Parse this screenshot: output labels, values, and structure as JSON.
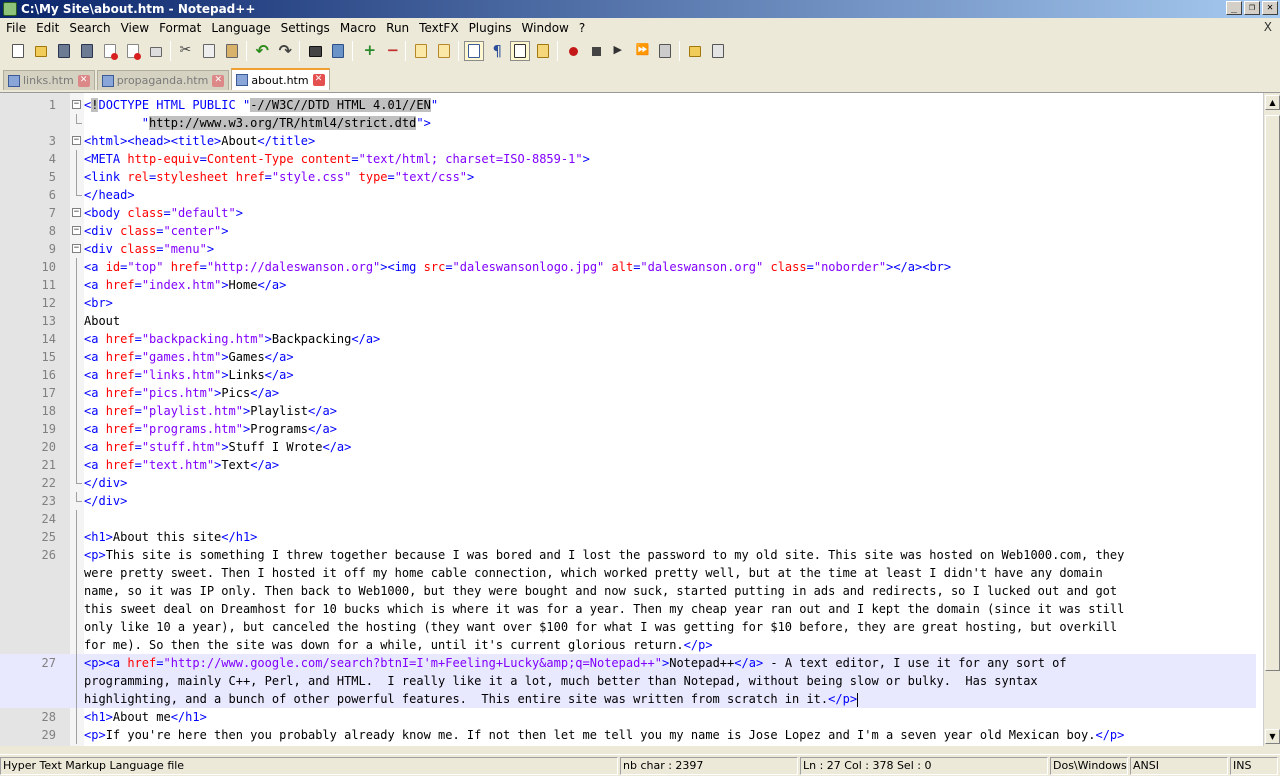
{
  "window": {
    "title": "C:\\My Site\\about.htm - Notepad++",
    "buttons": {
      "minimize": "_",
      "maximize": "❐",
      "close": "✕"
    },
    "doc_close": "X"
  },
  "menu": [
    "File",
    "Edit",
    "Search",
    "View",
    "Format",
    "Language",
    "Settings",
    "Macro",
    "Run",
    "TextFX",
    "Plugins",
    "Window",
    "?"
  ],
  "toolbar": [
    "new-file-icon",
    "open-file-icon",
    "save-icon",
    "save-all-icon",
    "close-icon",
    "close-all-icon",
    "print-icon",
    "cut-icon",
    "copy-icon",
    "paste-icon",
    "undo-icon",
    "redo-icon",
    "find-icon",
    "replace-icon",
    "zoom-in-icon",
    "zoom-out-icon",
    "sync-vertical-icon",
    "sync-horizontal-icon",
    "word-wrap-icon",
    "show-all-chars-icon",
    "indent-guide-icon",
    "user-language-icon",
    "record-macro-icon",
    "stop-record-icon",
    "playback-macro-icon",
    "run-macro-multiple-icon",
    "save-macro-icon",
    "open-folder-icon",
    "favorites-icon"
  ],
  "tabs": [
    {
      "label": "links.htm",
      "active": false
    },
    {
      "label": "propaganda.htm",
      "active": false
    },
    {
      "label": "about.htm",
      "active": true
    }
  ],
  "editor": {
    "colors": {
      "tag": "#0000ff",
      "attr": "#ff0000",
      "value": "#8000ff",
      "text": "#000000",
      "current_line": "#e8e8ff",
      "selection": "#c0c0c0"
    }
  },
  "status": {
    "type": "Hyper Text Markup Language file",
    "chars": "nb char : 2397",
    "pos": "Ln : 27    Col : 378    Sel : 0",
    "eol": "Dos\\Windows",
    "enc": "ANSI",
    "mode": "INS"
  },
  "lines": [
    {
      "n": "1",
      "fold": "box",
      "seg": [
        [
          "tg",
          "<"
        ],
        [
          "sl",
          "!"
        ],
        [
          "tg",
          "DOCTYPE HTML PUBLIC \""
        ],
        [
          "sl",
          "-//W3C//DTD HTML 4.01//EN"
        ],
        [
          "tg",
          "\""
        ]
      ]
    },
    {
      "n": "",
      "fold": "end",
      "seg": [
        [
          "tg",
          "        \""
        ],
        [
          "sl",
          "http://www.w3.org/TR/html4/strict.dtd"
        ],
        [
          "tg",
          "\">"
        ]
      ]
    },
    {
      "n": "3",
      "fold": "box",
      "seg": [
        [
          "tg",
          "<html><head><title>"
        ],
        [
          "t",
          "About"
        ],
        [
          "tg",
          "</title>"
        ]
      ]
    },
    {
      "n": "4",
      "fold": "line",
      "seg": [
        [
          "tg",
          "<META "
        ],
        [
          "at",
          "http-equiv"
        ],
        [
          "tg",
          "="
        ],
        [
          "at",
          "Content-Type"
        ],
        [
          "tg",
          " "
        ],
        [
          "at",
          "content"
        ],
        [
          "tg",
          "="
        ],
        [
          "vl",
          "\"text/html; charset=ISO-8859-1\""
        ],
        [
          "tg",
          ">"
        ]
      ]
    },
    {
      "n": "5",
      "fold": "line",
      "seg": [
        [
          "tg",
          "<link "
        ],
        [
          "at",
          "rel"
        ],
        [
          "tg",
          "="
        ],
        [
          "at",
          "stylesheet"
        ],
        [
          "tg",
          " "
        ],
        [
          "at",
          "href"
        ],
        [
          "tg",
          "="
        ],
        [
          "vl",
          "\"style.css\""
        ],
        [
          "tg",
          " "
        ],
        [
          "at",
          "type"
        ],
        [
          "tg",
          "="
        ],
        [
          "vl",
          "\"text/css\""
        ],
        [
          "tg",
          ">"
        ]
      ]
    },
    {
      "n": "6",
      "fold": "end",
      "seg": [
        [
          "tg",
          "</head>"
        ]
      ]
    },
    {
      "n": "7",
      "fold": "box",
      "seg": [
        [
          "tg",
          "<body "
        ],
        [
          "at",
          "class"
        ],
        [
          "tg",
          "="
        ],
        [
          "vl",
          "\"default\""
        ],
        [
          "tg",
          ">"
        ]
      ]
    },
    {
      "n": "8",
      "fold": "box",
      "seg": [
        [
          "tg",
          "<div "
        ],
        [
          "at",
          "class"
        ],
        [
          "tg",
          "="
        ],
        [
          "vl",
          "\"center\""
        ],
        [
          "tg",
          ">"
        ]
      ]
    },
    {
      "n": "9",
      "fold": "box",
      "seg": [
        [
          "tg",
          "<div "
        ],
        [
          "at",
          "class"
        ],
        [
          "tg",
          "="
        ],
        [
          "vl",
          "\"menu\""
        ],
        [
          "tg",
          ">"
        ]
      ]
    },
    {
      "n": "10",
      "fold": "line",
      "seg": [
        [
          "tg",
          "<a "
        ],
        [
          "at",
          "id"
        ],
        [
          "tg",
          "="
        ],
        [
          "vl",
          "\"top\""
        ],
        [
          "tg",
          " "
        ],
        [
          "at",
          "href"
        ],
        [
          "tg",
          "="
        ],
        [
          "vl",
          "\"http://daleswanson.org\""
        ],
        [
          "tg",
          "><img "
        ],
        [
          "at",
          "src"
        ],
        [
          "tg",
          "="
        ],
        [
          "vl",
          "\"daleswansonlogo.jpg\""
        ],
        [
          "tg",
          " "
        ],
        [
          "at",
          "alt"
        ],
        [
          "tg",
          "="
        ],
        [
          "vl",
          "\"daleswanson.org\""
        ],
        [
          "tg",
          " "
        ],
        [
          "at",
          "class"
        ],
        [
          "tg",
          "="
        ],
        [
          "vl",
          "\"noborder\""
        ],
        [
          "tg",
          "></a><br>"
        ]
      ]
    },
    {
      "n": "11",
      "fold": "line",
      "seg": [
        [
          "tg",
          "<a "
        ],
        [
          "at",
          "href"
        ],
        [
          "tg",
          "="
        ],
        [
          "vl",
          "\"index.htm\""
        ],
        [
          "tg",
          ">"
        ],
        [
          "t",
          "Home"
        ],
        [
          "tg",
          "</a>"
        ]
      ]
    },
    {
      "n": "12",
      "fold": "line",
      "seg": [
        [
          "tg",
          "<br>"
        ]
      ]
    },
    {
      "n": "13",
      "fold": "line",
      "seg": [
        [
          "t",
          "About"
        ]
      ]
    },
    {
      "n": "14",
      "fold": "line",
      "seg": [
        [
          "tg",
          "<a "
        ],
        [
          "at",
          "href"
        ],
        [
          "tg",
          "="
        ],
        [
          "vl",
          "\"backpacking.htm\""
        ],
        [
          "tg",
          ">"
        ],
        [
          "t",
          "Backpacking"
        ],
        [
          "tg",
          "</a>"
        ]
      ]
    },
    {
      "n": "15",
      "fold": "line",
      "seg": [
        [
          "tg",
          "<a "
        ],
        [
          "at",
          "href"
        ],
        [
          "tg",
          "="
        ],
        [
          "vl",
          "\"games.htm\""
        ],
        [
          "tg",
          ">"
        ],
        [
          "t",
          "Games"
        ],
        [
          "tg",
          "</a>"
        ]
      ]
    },
    {
      "n": "16",
      "fold": "line",
      "seg": [
        [
          "tg",
          "<a "
        ],
        [
          "at",
          "href"
        ],
        [
          "tg",
          "="
        ],
        [
          "vl",
          "\"links.htm\""
        ],
        [
          "tg",
          ">"
        ],
        [
          "t",
          "Links"
        ],
        [
          "tg",
          "</a>"
        ]
      ]
    },
    {
      "n": "17",
      "fold": "line",
      "seg": [
        [
          "tg",
          "<a "
        ],
        [
          "at",
          "href"
        ],
        [
          "tg",
          "="
        ],
        [
          "vl",
          "\"pics.htm\""
        ],
        [
          "tg",
          ">"
        ],
        [
          "t",
          "Pics"
        ],
        [
          "tg",
          "</a>"
        ]
      ]
    },
    {
      "n": "18",
      "fold": "line",
      "seg": [
        [
          "tg",
          "<a "
        ],
        [
          "at",
          "href"
        ],
        [
          "tg",
          "="
        ],
        [
          "vl",
          "\"playlist.htm\""
        ],
        [
          "tg",
          ">"
        ],
        [
          "t",
          "Playlist"
        ],
        [
          "tg",
          "</a>"
        ]
      ]
    },
    {
      "n": "19",
      "fold": "line",
      "seg": [
        [
          "tg",
          "<a "
        ],
        [
          "at",
          "href"
        ],
        [
          "tg",
          "="
        ],
        [
          "vl",
          "\"programs.htm\""
        ],
        [
          "tg",
          ">"
        ],
        [
          "t",
          "Programs"
        ],
        [
          "tg",
          "</a>"
        ]
      ]
    },
    {
      "n": "20",
      "fold": "line",
      "seg": [
        [
          "tg",
          "<a "
        ],
        [
          "at",
          "href"
        ],
        [
          "tg",
          "="
        ],
        [
          "vl",
          "\"stuff.htm\""
        ],
        [
          "tg",
          ">"
        ],
        [
          "t",
          "Stuff I Wrote"
        ],
        [
          "tg",
          "</a>"
        ]
      ]
    },
    {
      "n": "21",
      "fold": "line",
      "seg": [
        [
          "tg",
          "<a "
        ],
        [
          "at",
          "href"
        ],
        [
          "tg",
          "="
        ],
        [
          "vl",
          "\"text.htm\""
        ],
        [
          "tg",
          ">"
        ],
        [
          "t",
          "Text"
        ],
        [
          "tg",
          "</a>"
        ]
      ]
    },
    {
      "n": "22",
      "fold": "end",
      "seg": [
        [
          "tg",
          "</div>"
        ]
      ]
    },
    {
      "n": "23",
      "fold": "end",
      "seg": [
        [
          "tg",
          "</div>"
        ]
      ]
    },
    {
      "n": "24",
      "fold": "line",
      "seg": []
    },
    {
      "n": "25",
      "fold": "line",
      "seg": [
        [
          "tg",
          "<h1>"
        ],
        [
          "t",
          "About this site"
        ],
        [
          "tg",
          "</h1>"
        ]
      ]
    },
    {
      "n": "26",
      "fold": "line",
      "seg": [
        [
          "tg",
          "<p>"
        ],
        [
          "t",
          "This site is something I threw together because I was bored and I lost the password to my old site. This site was hosted on Web1000.com, they"
        ]
      ]
    },
    {
      "n": "",
      "fold": "line",
      "seg": [
        [
          "t",
          "were pretty sweet. Then I hosted it off my home cable connection, which worked pretty well, but at the time at least I didn't have any domain"
        ]
      ]
    },
    {
      "n": "",
      "fold": "line",
      "seg": [
        [
          "t",
          "name, so it was IP only. Then back to Web1000, but they were bought and now suck, started putting in ads and redirects, so I lucked out and got"
        ]
      ]
    },
    {
      "n": "",
      "fold": "line",
      "seg": [
        [
          "t",
          "this sweet deal on Dreamhost for 10 bucks which is where it was for a year. Then my cheap year ran out and I kept the domain (since it was still"
        ]
      ]
    },
    {
      "n": "",
      "fold": "line",
      "seg": [
        [
          "t",
          "only like 10 a year), but canceled the hosting (they want over $100 for what I was getting for $10 before, they are great hosting, but overkill"
        ]
      ]
    },
    {
      "n": "",
      "fold": "line",
      "seg": [
        [
          "t",
          "for me). So then the site was down for a while, until it's current glorious return."
        ],
        [
          "tg",
          "</p>"
        ]
      ]
    },
    {
      "n": "27",
      "fold": "line",
      "cur": true,
      "seg": [
        [
          "tg",
          "<p><a "
        ],
        [
          "at",
          "href"
        ],
        [
          "tg",
          "="
        ],
        [
          "vl",
          "\"http://www.google.com/search?btnI=I'm+Feeling+Lucky&amp;q=Notepad++\""
        ],
        [
          "tg",
          ">"
        ],
        [
          "t",
          "Notepad++"
        ],
        [
          "tg",
          "</a>"
        ],
        [
          "t",
          " - A text editor, I use it for any sort of"
        ]
      ]
    },
    {
      "n": "",
      "fold": "line",
      "cur": true,
      "seg": [
        [
          "t",
          "programming, mainly C++, Perl, and HTML.  I really like it a lot, much better than Notepad, without being slow or bulky.  Has syntax"
        ]
      ]
    },
    {
      "n": "",
      "fold": "line",
      "cur": true,
      "caret": true,
      "seg": [
        [
          "t",
          "highlighting, and a bunch of other powerful features.  This entire site was written from scratch in it."
        ],
        [
          "tg",
          "</p>"
        ]
      ]
    },
    {
      "n": "28",
      "fold": "line",
      "seg": [
        [
          "tg",
          "<h1>"
        ],
        [
          "t",
          "About me"
        ],
        [
          "tg",
          "</h1>"
        ]
      ]
    },
    {
      "n": "29",
      "fold": "line",
      "seg": [
        [
          "tg",
          "<p>"
        ],
        [
          "t",
          "If you're here then you probably already know me. If not then let me tell you my name is Jose Lopez and I'm a seven year old Mexican boy."
        ],
        [
          "tg",
          "</p>"
        ]
      ]
    }
  ]
}
